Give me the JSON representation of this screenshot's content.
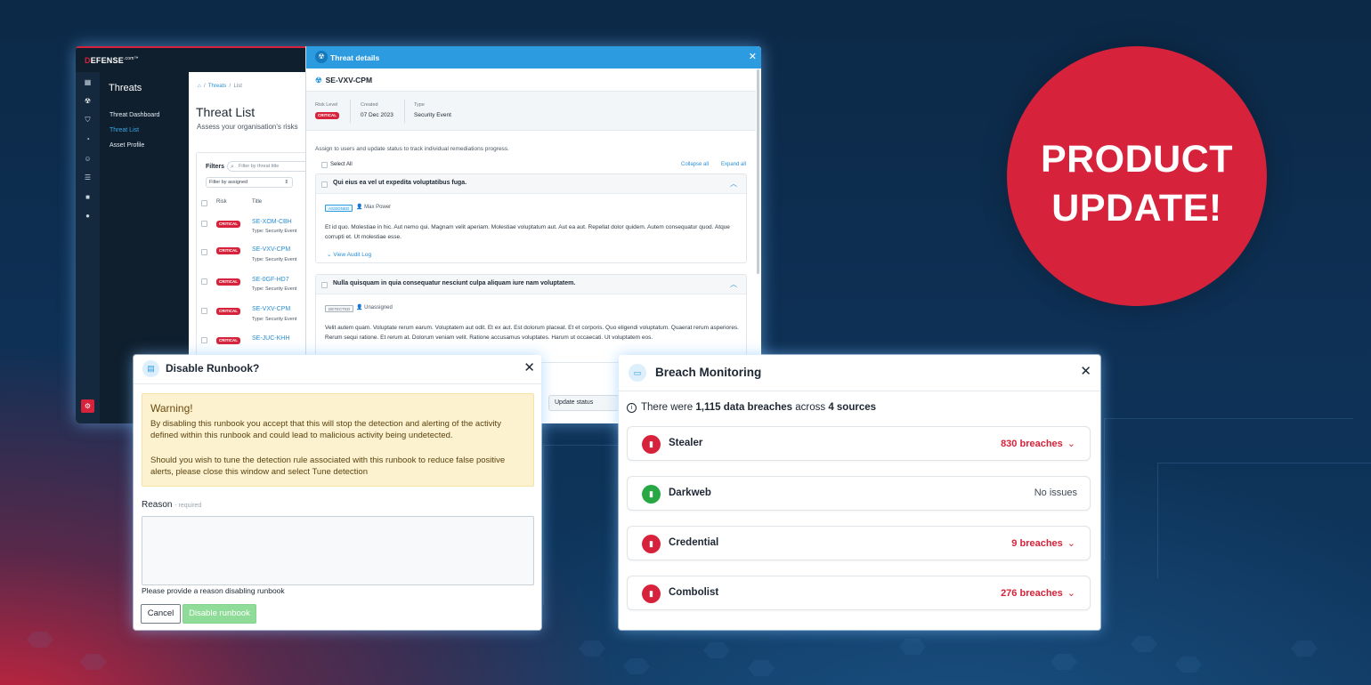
{
  "brand": {
    "logo_prefix": "D",
    "logo_text": "EFENSE",
    "logo_suffix": ".com™"
  },
  "badge": {
    "line1": "PRODUCT",
    "line2": "UPDATE!"
  },
  "sidebar": {
    "section_title": "Threats",
    "items": [
      {
        "label": "Threat Dashboard"
      },
      {
        "label": "Threat List"
      },
      {
        "label": "Asset Profile"
      }
    ]
  },
  "breadcrumb": {
    "home": "⌂",
    "threats": "Threats",
    "current": "List"
  },
  "page": {
    "title": "Threat List",
    "subtitle": "Assess your organisation's risks"
  },
  "filters": {
    "label": "Filters",
    "search_placeholder": "Filter by threat title",
    "assigned_label": "Filter by assigned"
  },
  "table": {
    "headers": [
      "Risk",
      "Title"
    ],
    "rows": [
      {
        "risk": "CRITICAL",
        "id": "SE-XOM-CBH",
        "type": "Type: Security Event"
      },
      {
        "risk": "CRITICAL",
        "id": "SE-VXV-CPM",
        "type": "Type: Security Event"
      },
      {
        "risk": "CRITICAL",
        "id": "SE-0GF-HD7",
        "type": "Type: Security Event"
      },
      {
        "risk": "CRITICAL",
        "id": "SE-VXV-CPM",
        "type": "Type: Security Event"
      },
      {
        "risk": "CRITICAL",
        "id": "SE-JUC-KHH",
        "type": ""
      }
    ]
  },
  "threat_details": {
    "header": "Threat details",
    "id": "SE-VXV-CPM",
    "risk_level_label": "Risk Level",
    "risk_level": "CRITICAL",
    "created_label": "Created",
    "created": "07 Dec 2023",
    "type_label": "Type",
    "type": "Security Event",
    "assign_text": "Assign to users and update status to track individual remediations progress.",
    "select_all": "Select All",
    "collapse_all": "Collapse all",
    "expand_all": "Expand all",
    "items": [
      {
        "title": "Qui eius ea vel ut expedita voluptatibus fuga.",
        "status": "ASSIGNED",
        "assignee": "Max Power",
        "body": "Et id quo. Molestiae in hic. Aut nemo qui. Magnam velit aperiam. Molestiae voluptatum aut. Aut ea aut. Repellat dolor quidem. Autem consequatur quod. Atque corrupti et. Ut molestiae esse.",
        "audit": "View Audit Log"
      },
      {
        "title": "Nulla quisquam in quia consequatur nesciunt culpa aliquam iure nam voluptatem.",
        "status": "DETECTED",
        "assignee": "Unassigned",
        "body": "Velit autem quam. Voluptate rerum earum. Voluptatem aut odit. Et ex aut. Est dolorum placeat. Et et corporis. Quo eligendi voluptatum. Quaerat rerum asperiores. Rerum sequi ratione. Et rerum at. Dolorum veniam velit. Ratione accusamus voluptates. Harum ut occaecati. Ut voluptatem eos."
      }
    ],
    "update_status": "Update status"
  },
  "disable_runbook": {
    "title": "Disable Runbook?",
    "warning_title": "Warning!",
    "warning_p1": "By disabling this runbook you accept that this will stop the detection and alerting of the activity defined within this runbook and could lead to malicious activity being undetected.",
    "warning_p2": "Should you wish to tune the detection rule associated with this runbook to reduce false positive alerts, please close this window and select Tune detection",
    "reason_label": "Reason",
    "reason_required": "- required",
    "reason_value": "",
    "hint": "Please provide a reason disabling runbook",
    "cancel": "Cancel",
    "disable": "Disable runbook"
  },
  "breach": {
    "title": "Breach Monitoring",
    "summary_prefix": "There were ",
    "summary_count": "1,115 data breaches",
    "summary_mid": " across ",
    "summary_sources": "4 sources",
    "sources": [
      {
        "name": "Stealer",
        "status": "830 breaches",
        "color": "#d6223a"
      },
      {
        "name": "Darkweb",
        "status": "No issues",
        "color": "#27a845"
      },
      {
        "name": "Credential",
        "status": "9 breaches",
        "color": "#d6223a"
      },
      {
        "name": "Combolist",
        "status": "276 breaches",
        "color": "#d6223a"
      }
    ]
  }
}
